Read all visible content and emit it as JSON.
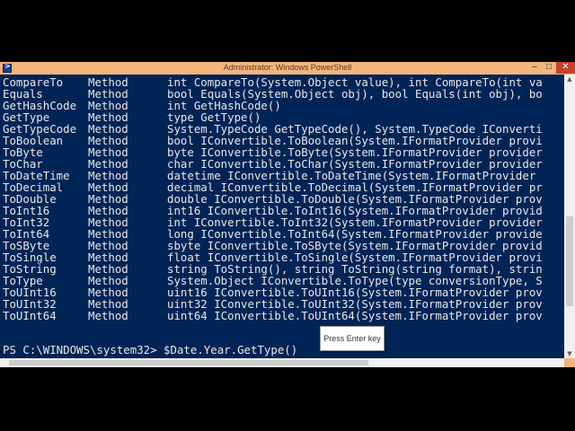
{
  "window": {
    "title": "Administrator: Windows PowerShell",
    "minimize": "–",
    "maximize": "□",
    "close": "✕"
  },
  "colors": {
    "console_bg": "#012456",
    "console_text": "#e8e8e8",
    "titlebar": "#f3b57c",
    "close_button": "#c8402f"
  },
  "rows": [
    {
      "name": "CompareTo",
      "type": "Method",
      "definition": "int CompareTo(System.Object value), int CompareTo(int va"
    },
    {
      "name": "Equals",
      "type": "Method",
      "definition": "bool Equals(System.Object obj), bool Equals(int obj), bo"
    },
    {
      "name": "GetHashCode",
      "type": "Method",
      "definition": "int GetHashCode()"
    },
    {
      "name": "GetType",
      "type": "Method",
      "definition": "type GetType()"
    },
    {
      "name": "GetTypeCode",
      "type": "Method",
      "definition": "System.TypeCode GetTypeCode(), System.TypeCode IConverti"
    },
    {
      "name": "ToBoolean",
      "type": "Method",
      "definition": "bool IConvertible.ToBoolean(System.IFormatProvider provi"
    },
    {
      "name": "ToByte",
      "type": "Method",
      "definition": "byte IConvertible.ToByte(System.IFormatProvider provider"
    },
    {
      "name": "ToChar",
      "type": "Method",
      "definition": "char IConvertible.ToChar(System.IFormatProvider provider"
    },
    {
      "name": "ToDateTime",
      "type": "Method",
      "definition": "datetime IConvertible.ToDateTime(System.IFormatProvider"
    },
    {
      "name": "ToDecimal",
      "type": "Method",
      "definition": "decimal IConvertible.ToDecimal(System.IFormatProvider pr"
    },
    {
      "name": "ToDouble",
      "type": "Method",
      "definition": "double IConvertible.ToDouble(System.IFormatProvider prov"
    },
    {
      "name": "ToInt16",
      "type": "Method",
      "definition": "int16 IConvertible.ToInt16(System.IFormatProvider provid"
    },
    {
      "name": "ToInt32",
      "type": "Method",
      "definition": "int IConvertible.ToInt32(System.IFormatProvider provider"
    },
    {
      "name": "ToInt64",
      "type": "Method",
      "definition": "long IConvertible.ToInt64(System.IFormatProvider provide"
    },
    {
      "name": "ToSByte",
      "type": "Method",
      "definition": "sbyte IConvertible.ToSByte(System.IFormatProvider provid"
    },
    {
      "name": "ToSingle",
      "type": "Method",
      "definition": "float IConvertible.ToSingle(System.IFormatProvider provi"
    },
    {
      "name": "ToString",
      "type": "Method",
      "definition": "string ToString(), string ToString(string format), strin"
    },
    {
      "name": "ToType",
      "type": "Method",
      "definition": "System.Object IConvertible.ToType(type conversionType, S"
    },
    {
      "name": "ToUInt16",
      "type": "Method",
      "definition": "uint16 IConvertible.ToUInt16(System.IFormatProvider prov"
    },
    {
      "name": "ToUInt32",
      "type": "Method",
      "definition": "uint32 IConvertible.ToUInt32(System.IFormatProvider prov"
    },
    {
      "name": "ToUInt64",
      "type": "Method",
      "definition": "uint64 IConvertible.ToUInt64(System.IFormatProvider prov"
    }
  ],
  "prompt": "PS C:\\WINDOWS\\system32> $Date.Year.GetType()",
  "tooltip": "Press Enter key"
}
